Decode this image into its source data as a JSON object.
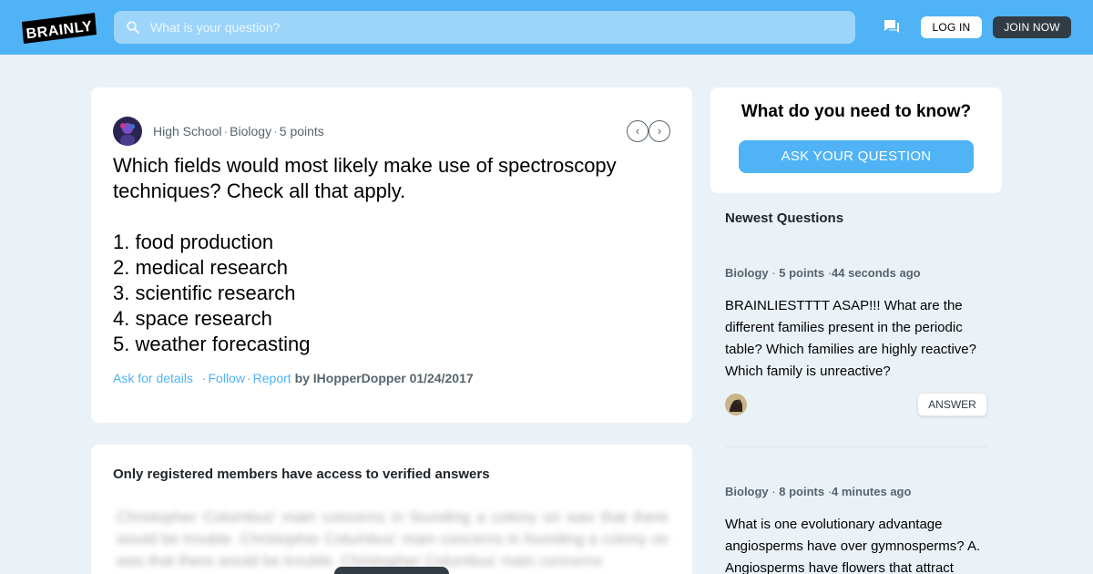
{
  "header": {
    "logo_text": "BRAINLY",
    "search_placeholder": "What is your question?",
    "login_label": "LOG IN",
    "join_label": "JOIN NOW",
    "brand_color": "#4fb3f6",
    "icons": [
      "search-icon",
      "chat-icon"
    ]
  },
  "question": {
    "level": "High School",
    "subject": "Biology",
    "points": "5 points",
    "title_line1": "Which fields would most likely make use of spectroscopy",
    "title_line2": "techniques? Check all that apply.",
    "options": [
      "1. food production",
      "2. medical research",
      "3. scientific research",
      "4. space research",
      "5. weather forecasting"
    ],
    "ask_details": "Ask for details",
    "follow": "Follow",
    "report": "Report",
    "by_label": "by",
    "author": "IHopperDopper",
    "date": "01/24/2017",
    "nav_prev": "‹",
    "nav_next": "›"
  },
  "answer_section": {
    "notice": "Only registered members have access to verified answers",
    "blurred_text": "Christopher Columbus' main concerns in founding a colony on was that there would be trouble. Christopher Columbus' main concerns in founding a colony on was that there would be trouble. Christopher Columbus' main concerns"
  },
  "ask_card": {
    "title": "What do you need to know?",
    "button_label": "ASK YOUR QUESTION"
  },
  "newest": {
    "title": "Newest Questions",
    "items": [
      {
        "subject": "Biology",
        "points": "5 points",
        "time": "44 seconds ago",
        "text": "BRAINLIESTTTT ASAP!!! What are the different families present in the periodic table? Which families are highly reactive? Which family is unreactive?",
        "answer_label": "ANSWER"
      },
      {
        "subject": "Biology",
        "points": "8 points",
        "time": "4 minutes ago",
        "text": "What is one evolutionary advantage angiosperms have over gymnosperms? A. Angiosperms have flowers that attract"
      }
    ]
  }
}
